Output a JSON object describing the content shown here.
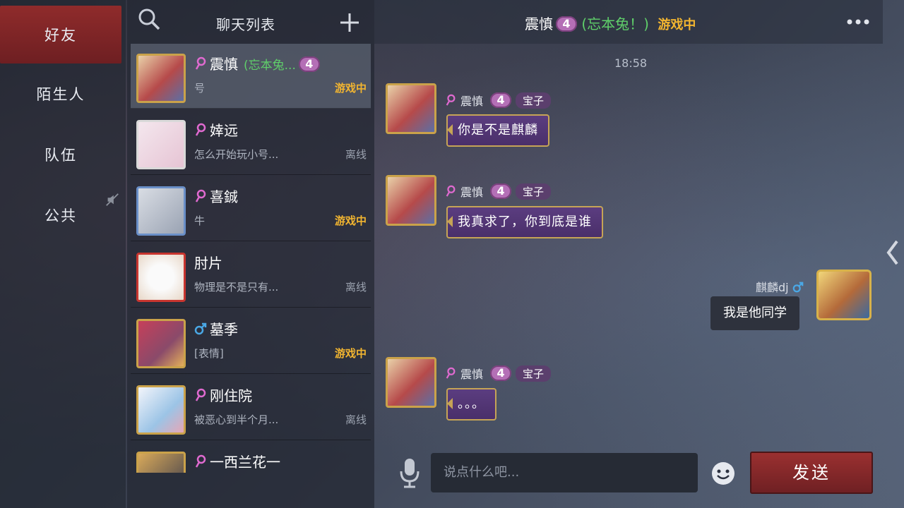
{
  "tabs": [
    {
      "label": "好友",
      "active": true
    },
    {
      "label": "陌生人"
    },
    {
      "label": "队伍"
    },
    {
      "label": "公共"
    }
  ],
  "list": {
    "title": "聊天列表",
    "rows": [
      {
        "name": "震慎",
        "remark": "(忘本兔...",
        "level": "4",
        "msg": "号",
        "status": "游戏中",
        "gender": "female"
      },
      {
        "name": "婞远",
        "msg": "怎么开始玩小号...",
        "status": "离线",
        "gender": "female"
      },
      {
        "name": "喜鋮",
        "msg": "牛",
        "status": "游戏中",
        "gender": "female"
      },
      {
        "name": "肘片",
        "msg": "物理是不是只有...",
        "status": "离线",
        "gender": ""
      },
      {
        "name": "墓季",
        "msg": "[表情]",
        "status": "游戏中",
        "gender": "male"
      },
      {
        "name": "刚住院",
        "msg": "被恶心到半个月...",
        "status": "离线",
        "gender": "female"
      },
      {
        "name": "一西兰花一",
        "msg": "",
        "status": "",
        "gender": "female"
      }
    ]
  },
  "chat": {
    "header": {
      "name": "震慎",
      "level": "4",
      "remark": "(忘本兔！)",
      "status": "游戏中"
    },
    "time": "18:58",
    "sender": {
      "name": "震慎",
      "level": "4",
      "tag": "宝子"
    },
    "messages": [
      {
        "text": "你是不是麒麟"
      },
      {
        "text": "我真求了，你到底是谁"
      },
      {
        "text": "。。。"
      }
    ],
    "me": {
      "name": "麒麟dj",
      "text": "我是他同学"
    }
  },
  "input": {
    "placeholder": "说点什么吧...",
    "send_label": "发送"
  },
  "colors": {
    "accent_red": "#8f2b2b",
    "online": "#f2b530",
    "remark_green": "#5fcf6a",
    "bubble_purple": "#5b3d80"
  }
}
